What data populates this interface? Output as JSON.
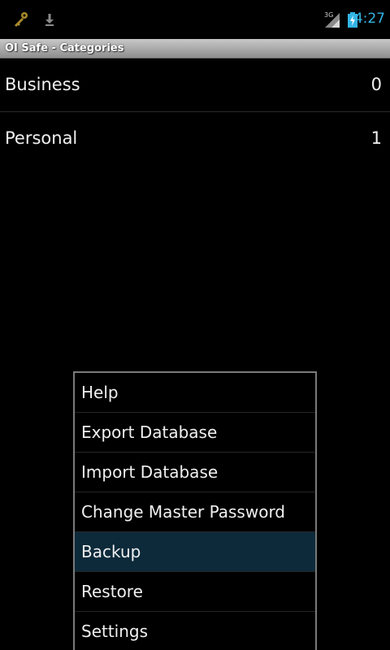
{
  "status_bar": {
    "time": "4:27",
    "network": "3G",
    "icons": [
      "key-icon",
      "download-icon",
      "signal-icon",
      "battery-charging-icon"
    ],
    "time_color": "#33b5e5"
  },
  "app": {
    "title": "OI Safe - Categories"
  },
  "categories": [
    {
      "name": "Business",
      "count": "0"
    },
    {
      "name": "Personal",
      "count": "1"
    }
  ],
  "menu": {
    "items": [
      {
        "label": "Help"
      },
      {
        "label": "Export Database"
      },
      {
        "label": "Import Database"
      },
      {
        "label": "Change Master Password"
      },
      {
        "label": "Backup"
      },
      {
        "label": "Restore"
      },
      {
        "label": "Settings"
      }
    ],
    "selected_index": 4,
    "highlight_color": "#0c2a3a"
  }
}
